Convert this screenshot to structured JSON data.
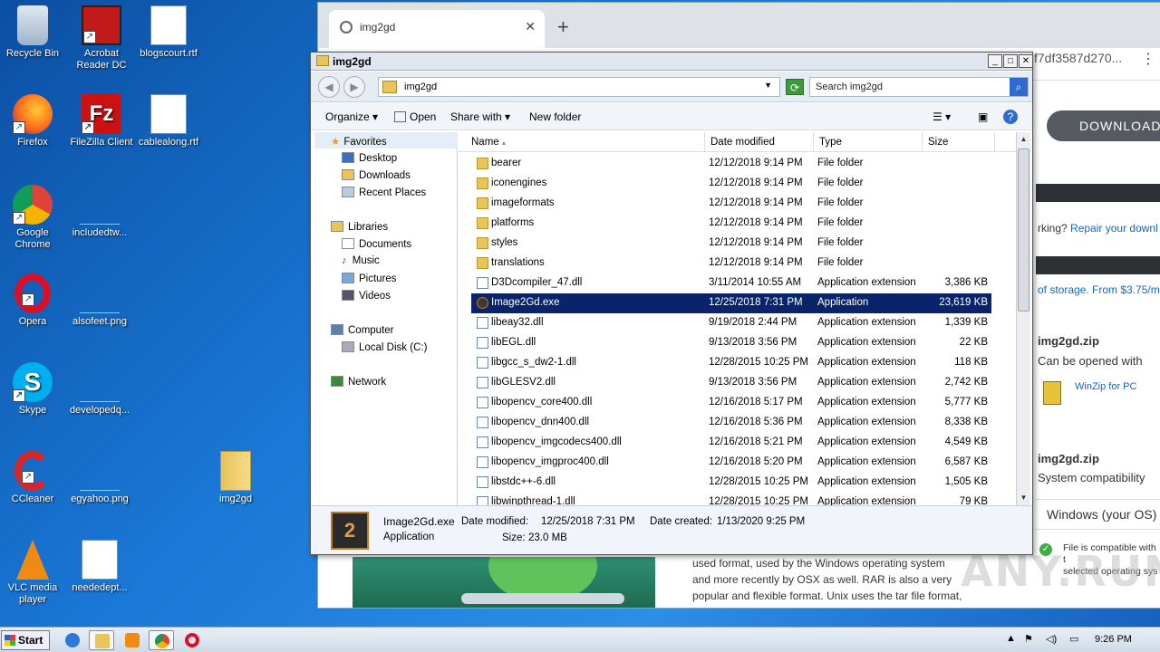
{
  "desktop": {
    "icons": [
      {
        "label": "Recycle Bin"
      },
      {
        "label": "Acrobat Reader DC"
      },
      {
        "label": "blogscourt.rtf"
      },
      {
        "label": "Firefox"
      },
      {
        "label": "FileZilla Client"
      },
      {
        "label": "cablealong.rtf"
      },
      {
        "label": "Google Chrome"
      },
      {
        "label": "includedtw..."
      },
      {
        "label": "Opera"
      },
      {
        "label": "alsofeet.png"
      },
      {
        "label": "Skype"
      },
      {
        "label": "developedq..."
      },
      {
        "label": "CCleaner"
      },
      {
        "label": "egyahoo.png"
      },
      {
        "label": "img2gd"
      },
      {
        "label": "VLC media player"
      },
      {
        "label": "neededept..."
      }
    ]
  },
  "browser": {
    "tab_title": "img2gd",
    "new_tab": "+",
    "tab_close": "✕",
    "url_fragment": "f7df3587d270...",
    "menu": "⋮",
    "download_label": "DOWNLOAD",
    "repair_prefix": "rking?",
    "repair_link": "Repair your downl",
    "storage_link": "of storage. From $3.75/m",
    "file1_name": "img2gd.zip",
    "file1_sub": "Can be opened with",
    "winzip": "WinZip for PC",
    "file2_name": "img2gd.zip",
    "file2_sub": "System compatibility",
    "os_label": "Windows (your OS)",
    "compat_line1": "File is compatible with t",
    "compat_line2": "selected operating sys",
    "para_line1": "used format, used by the Windows operating system",
    "para_line2": "and more recently by OSX as well. RAR is also a very",
    "para_line3": "popular and flexible format. Unix uses the tar file format,",
    "watermark": "ANY.RUN"
  },
  "explorer": {
    "title": "img2gd",
    "address_path": "img2gd",
    "search_placeholder": "Search img2gd",
    "toolbar": {
      "organize": "Organize",
      "open": "Open",
      "share_with": "Share with",
      "new_folder": "New folder"
    },
    "nav": {
      "favorites": "Favorites",
      "desktop": "Desktop",
      "downloads": "Downloads",
      "recent": "Recent Places",
      "libraries": "Libraries",
      "documents": "Documents",
      "music": "Music",
      "pictures": "Pictures",
      "videos": "Videos",
      "computer": "Computer",
      "local_disk": "Local Disk (C:)",
      "network": "Network"
    },
    "columns": {
      "name": "Name",
      "date": "Date modified",
      "type": "Type",
      "size": "Size"
    },
    "files": [
      {
        "kind": "folder",
        "name": "bearer",
        "date": "12/12/2018 9:14 PM",
        "type": "File folder",
        "size": ""
      },
      {
        "kind": "folder",
        "name": "iconengines",
        "date": "12/12/2018 9:14 PM",
        "type": "File folder",
        "size": ""
      },
      {
        "kind": "folder",
        "name": "imageformats",
        "date": "12/12/2018 9:14 PM",
        "type": "File folder",
        "size": ""
      },
      {
        "kind": "folder",
        "name": "platforms",
        "date": "12/12/2018 9:14 PM",
        "type": "File folder",
        "size": ""
      },
      {
        "kind": "folder",
        "name": "styles",
        "date": "12/12/2018 9:14 PM",
        "type": "File folder",
        "size": ""
      },
      {
        "kind": "folder",
        "name": "translations",
        "date": "12/12/2018 9:14 PM",
        "type": "File folder",
        "size": ""
      },
      {
        "kind": "dll",
        "name": "D3Dcompiler_47.dll",
        "date": "3/11/2014 10:55 AM",
        "type": "Application extension",
        "size": "3,386 KB"
      },
      {
        "kind": "exe",
        "name": "Image2Gd.exe",
        "date": "12/25/2018 7:31 PM",
        "type": "Application",
        "size": "23,619 KB",
        "selected": true
      },
      {
        "kind": "dll",
        "name": "libeay32.dll",
        "date": "9/19/2018 2:44 PM",
        "type": "Application extension",
        "size": "1,339 KB"
      },
      {
        "kind": "dll",
        "name": "libEGL.dll",
        "date": "9/13/2018 3:56 PM",
        "type": "Application extension",
        "size": "22 KB"
      },
      {
        "kind": "dll",
        "name": "libgcc_s_dw2-1.dll",
        "date": "12/28/2015 10:25 PM",
        "type": "Application extension",
        "size": "118 KB"
      },
      {
        "kind": "dll",
        "name": "libGLESV2.dll",
        "date": "9/13/2018 3:56 PM",
        "type": "Application extension",
        "size": "2,742 KB"
      },
      {
        "kind": "dll",
        "name": "libopencv_core400.dll",
        "date": "12/16/2018 5:17 PM",
        "type": "Application extension",
        "size": "5,777 KB"
      },
      {
        "kind": "dll",
        "name": "libopencv_dnn400.dll",
        "date": "12/16/2018 5:36 PM",
        "type": "Application extension",
        "size": "8,338 KB"
      },
      {
        "kind": "dll",
        "name": "libopencv_imgcodecs400.dll",
        "date": "12/16/2018 5:21 PM",
        "type": "Application extension",
        "size": "4,549 KB"
      },
      {
        "kind": "dll",
        "name": "libopencv_imgproc400.dll",
        "date": "12/16/2018 5:20 PM",
        "type": "Application extension",
        "size": "6,587 KB"
      },
      {
        "kind": "dll",
        "name": "libstdc++-6.dll",
        "date": "12/28/2015 10:25 PM",
        "type": "Application extension",
        "size": "1,505 KB"
      },
      {
        "kind": "dll",
        "name": "libwinpthread-1.dll",
        "date": "12/28/2015 10:25 PM",
        "type": "Application extension",
        "size": "79 KB"
      }
    ],
    "details": {
      "icon_glyph": "2",
      "name": "Image2Gd.exe",
      "kind": "Application",
      "modified_label": "Date modified:",
      "modified": "12/25/2018 7:31 PM",
      "created_label": "Date created:",
      "created": "1/13/2020 9:25 PM",
      "size_label": "Size:",
      "size": "23.0 MB"
    }
  },
  "taskbar": {
    "start": "Start",
    "clock": "9:26 PM"
  },
  "colors": {
    "selection": "#0a246a",
    "desktop": "#1a78d6",
    "taskbar": "#cfdbe9"
  }
}
